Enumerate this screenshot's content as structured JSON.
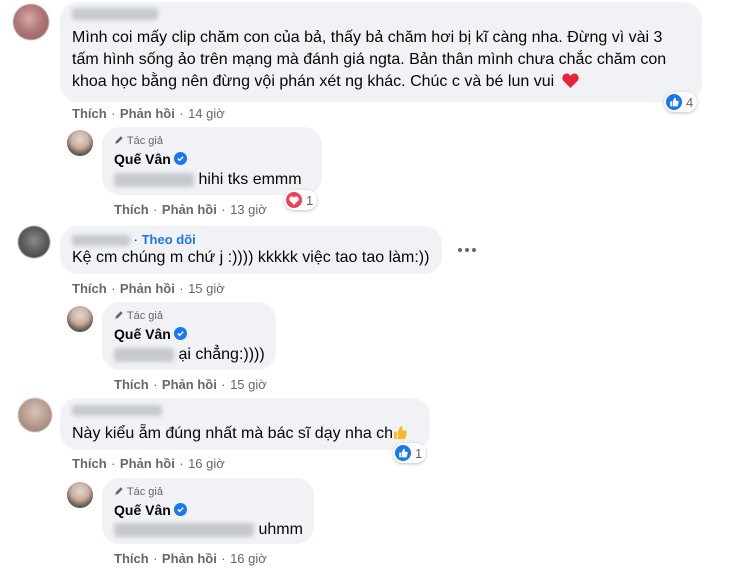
{
  "comments": [
    {
      "text": "Mình coi mấy clip chăm con của bả, thấy bả chăm hơi bị kĩ càng nha. Đừng vì vài 3 tấm hình sống ảo trên mạng mà đánh giá ngta. Bản thân mình chưa chắc chăm con khoa học bằng nên đừng vội phán xét ng khác. Chúc c và bé lun vui ❤️",
      "line1": "Mình coi mấy clip chăm con của bả, thấy bả chăm hơi bị kĩ càng nha. Đừng vì vài 3",
      "line2": "tấm hình sống ảo trên mạng mà đánh giá ngta. Bản thân mình chưa chắc chăm con",
      "line3": "khoa học bằng nên đừng vội phán xét ng khác. Chúc c và bé lun vui",
      "like": "Thích",
      "reply": "Phản hồi",
      "time": "14 giờ",
      "reaction_count": "4",
      "reaction": "like"
    },
    {
      "author_tag": "Tác giả",
      "name": "Quế Vân",
      "text": "hihi tks emmm",
      "like": "Thích",
      "reply": "Phản hồi",
      "time": "13 giờ",
      "reaction_count": "1",
      "reaction": "love"
    },
    {
      "follow": "Theo dõi",
      "text": "Kệ cm chúng m chứ j :)))) kkkkk việc tao tao làm:))",
      "like": "Thích",
      "reply": "Phản hồi",
      "time": "15 giờ"
    },
    {
      "author_tag": "Tác giả",
      "name": "Quế Vân",
      "text": "ại chẳng:))))",
      "like": "Thích",
      "reply": "Phản hồi",
      "time": "15 giờ"
    },
    {
      "text": "Này kiểu ẵm đúng nhất mà bác sĩ dạy nha ch",
      "like": "Thích",
      "reply": "Phản hồi",
      "time": "16 giờ",
      "reaction_count": "1",
      "reaction": "like"
    },
    {
      "author_tag": "Tác giả",
      "name": "Quế Vân",
      "text": "uhmm",
      "like": "Thích",
      "reply": "Phản hồi",
      "time": "16 giờ"
    }
  ],
  "separator": "·",
  "colors": {
    "accent": "#1877f2",
    "heart": "#f33e58",
    "bubble": "#f0f2f5",
    "meta": "#65676b"
  },
  "icons": [
    "like-icon",
    "heart-icon",
    "verified-badge-icon",
    "pencil-icon",
    "more-options-icon",
    "thumbs-up-emoji-icon"
  ]
}
